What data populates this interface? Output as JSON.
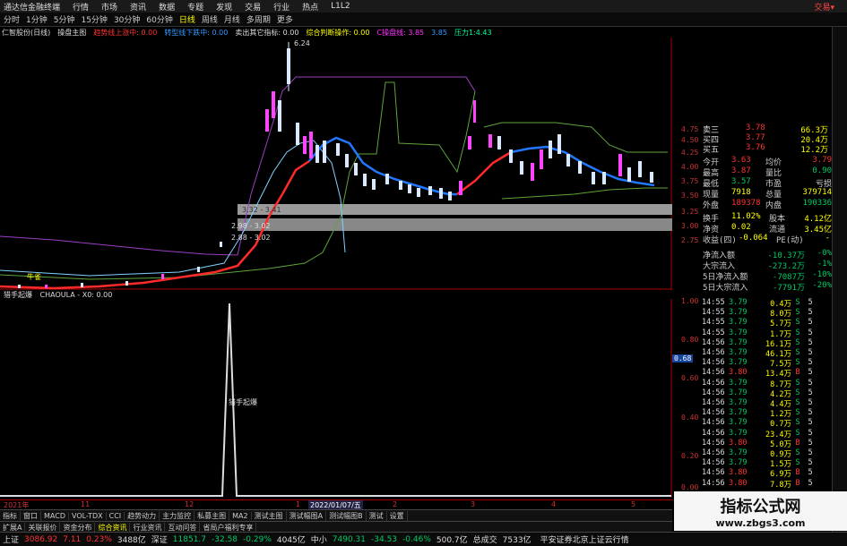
{
  "titlebar": {
    "app": "通达信金融终端",
    "menus": [
      "行情",
      "市场",
      "资讯",
      "数据",
      "专题",
      "发现",
      "交易",
      "行业",
      "热点",
      "L1L2"
    ],
    "right": "交易▾"
  },
  "toolbar": {
    "items": [
      "分时",
      "1分钟",
      "5分钟",
      "15分钟",
      "30分钟",
      "60分钟",
      "日线",
      "周线",
      "月线",
      "多周期",
      "更多"
    ],
    "selected": "日线"
  },
  "indicator_line": {
    "stock": "仁智股份(日线)",
    "items": [
      "操盘主图",
      "趋势线上涨中: 0.00",
      "转型线下跌中: 0.00",
      "卖出其它指标: 0.00",
      "综合判断操作: 0.00",
      "C操盘线: 3.85",
      "3.85",
      "压力1:4.43"
    ]
  },
  "main_chart": {
    "price_label_high": "6.24",
    "band_labels": [
      "3.32 - 3.41",
      "2.98 - 3.02",
      "2.88 - 3.02"
    ],
    "markers": [
      "牛雀"
    ]
  },
  "sub_chart": {
    "title": "猎手起爆",
    "formula": "CHAOULA - X0: 0.00",
    "annotation": "猎手起爆",
    "axis": [
      "1.00",
      "0.80",
      "0.60",
      "0.40",
      "0.20",
      "0.00"
    ],
    "cursor_value": "0.68"
  },
  "time_axis": {
    "labels": [
      "2021年",
      "11",
      "12",
      "1",
      "2022/01/07/五",
      "2",
      "3",
      "4",
      "5"
    ]
  },
  "quote": {
    "prices_axis": [
      "4.75",
      "4.50",
      "4.25",
      "4.00",
      "3.75",
      "3.50",
      "3.25",
      "3.00",
      "2.75"
    ],
    "asks": [
      {
        "label": "卖三",
        "price": "3.78",
        "vol": "66.3万"
      },
      {
        "label": "买四",
        "price": "3.77",
        "vol": "20.4万"
      },
      {
        "label": "买五",
        "price": "3.76",
        "vol": "12.2万"
      }
    ],
    "stats": [
      {
        "k1": "今开",
        "v1": "3.63",
        "k2": "均价",
        "v2": "3.79"
      },
      {
        "k1": "最高",
        "v1": "3.87",
        "k2": "量比",
        "v2": "0.90"
      },
      {
        "k1": "最低",
        "v1": "3.57",
        "k2": "市盈",
        "v2": "亏损"
      },
      {
        "k1": "现量",
        "v1": "7918",
        "k2": "总量",
        "v2": "379714"
      },
      {
        "k1": "外盘",
        "v1": "189378",
        "k2": "内盘",
        "v2": "190336"
      },
      {
        "k1": "换手",
        "v1": "11.02%",
        "k2": "股本",
        "v2": "4.12亿"
      },
      {
        "k1": "净资",
        "v1": "0.02",
        "k2": "流通",
        "v2": "3.45亿"
      },
      {
        "k1": "收益(四)",
        "v1": "-0.064",
        "k2": "PE(动)",
        "v2": "-"
      }
    ],
    "flows": [
      {
        "label": "净流入额",
        "value": "-10.37万",
        "pct": "-0%"
      },
      {
        "label": "大宗流入",
        "value": "-273.2万",
        "pct": "-1%"
      },
      {
        "label": "5日净流入额",
        "value": "-7087万",
        "pct": "-10%"
      },
      {
        "label": "5日大宗流入",
        "value": "-7791万",
        "pct": "-20%"
      }
    ],
    "ticks": [
      {
        "t": "14:55",
        "p": "3.79",
        "v": "0.4万",
        "s": "S",
        "n": "5"
      },
      {
        "t": "14:55",
        "p": "3.79",
        "v": "8.0万",
        "s": "S",
        "n": "5"
      },
      {
        "t": "14:55",
        "p": "3.79",
        "v": "5.7万",
        "s": "S",
        "n": "5"
      },
      {
        "t": "14:55",
        "p": "3.79",
        "v": "1.7万",
        "s": "S",
        "n": "5"
      },
      {
        "t": "14:56",
        "p": "3.79",
        "v": "16.1万",
        "s": "S",
        "n": "5"
      },
      {
        "t": "14:56",
        "p": "3.79",
        "v": "46.1万",
        "s": "S",
        "n": "5"
      },
      {
        "t": "14:56",
        "p": "3.79",
        "v": "7.5万",
        "s": "S",
        "n": "5"
      },
      {
        "t": "14:56",
        "p": "3.80",
        "v": "13.4万",
        "s": "B",
        "n": "5"
      },
      {
        "t": "14:56",
        "p": "3.79",
        "v": "8.7万",
        "s": "S",
        "n": "5"
      },
      {
        "t": "14:56",
        "p": "3.79",
        "v": "4.2万",
        "s": "S",
        "n": "5"
      },
      {
        "t": "14:56",
        "p": "3.79",
        "v": "4.4万",
        "s": "S",
        "n": "5"
      },
      {
        "t": "14:56",
        "p": "3.79",
        "v": "1.2万",
        "s": "S",
        "n": "5"
      },
      {
        "t": "14:56",
        "p": "3.79",
        "v": "0.7万",
        "s": "S",
        "n": "5"
      },
      {
        "t": "14:56",
        "p": "3.79",
        "v": "23.4万",
        "s": "S",
        "n": "5"
      },
      {
        "t": "14:56",
        "p": "3.80",
        "v": "5.0万",
        "s": "B",
        "n": "5"
      },
      {
        "t": "14:56",
        "p": "3.79",
        "v": "0.9万",
        "s": "S",
        "n": "5"
      },
      {
        "t": "14:56",
        "p": "3.79",
        "v": "1.5万",
        "s": "S",
        "n": "5"
      },
      {
        "t": "14:56",
        "p": "3.80",
        "v": "6.9万",
        "s": "B",
        "n": "5"
      },
      {
        "t": "14:56",
        "p": "3.80",
        "v": "7.8万",
        "s": "B",
        "n": "5"
      }
    ]
  },
  "bottom_tabs": [
    "指标",
    "窗口",
    "MACD",
    "VOL-TDX",
    "CCI",
    "趋势动力",
    "主力监控",
    "私募主图",
    "MA2",
    "测试主图",
    "测试幅图A",
    "测试幅图B",
    "测试",
    "设置"
  ],
  "bottom_tabs2": [
    "扩展A",
    "关联报价",
    "资金分布",
    "综合资讯",
    "行业资讯",
    "互动问答",
    "省局户福利专享"
  ],
  "watermark": {
    "title": "指标公式网",
    "url": "www.zbgs3.com"
  },
  "statusbar": [
    {
      "name": "上证",
      "val": "3086.92",
      "chg": "7.11",
      "pct": "0.23%",
      "amt": "3488亿"
    },
    {
      "name": "深证",
      "val": "11851.7",
      "chg": "-32.58",
      "pct": "-0.29%",
      "amt": "4045亿"
    },
    {
      "name": "中小",
      "val": "7490.31",
      "chg": "-34.53",
      "pct": "-0.46%",
      "amt": "500.7亿"
    },
    {
      "name": "总成交",
      "val": "7533亿",
      "chg": "",
      "pct": "",
      "amt": ""
    }
  ],
  "status_right": "平安证券北京上证云行情",
  "colors": {
    "up": "#ff3333",
    "down": "#00cc66",
    "yellow": "#ffff00",
    "cyan": "#00ffff"
  }
}
